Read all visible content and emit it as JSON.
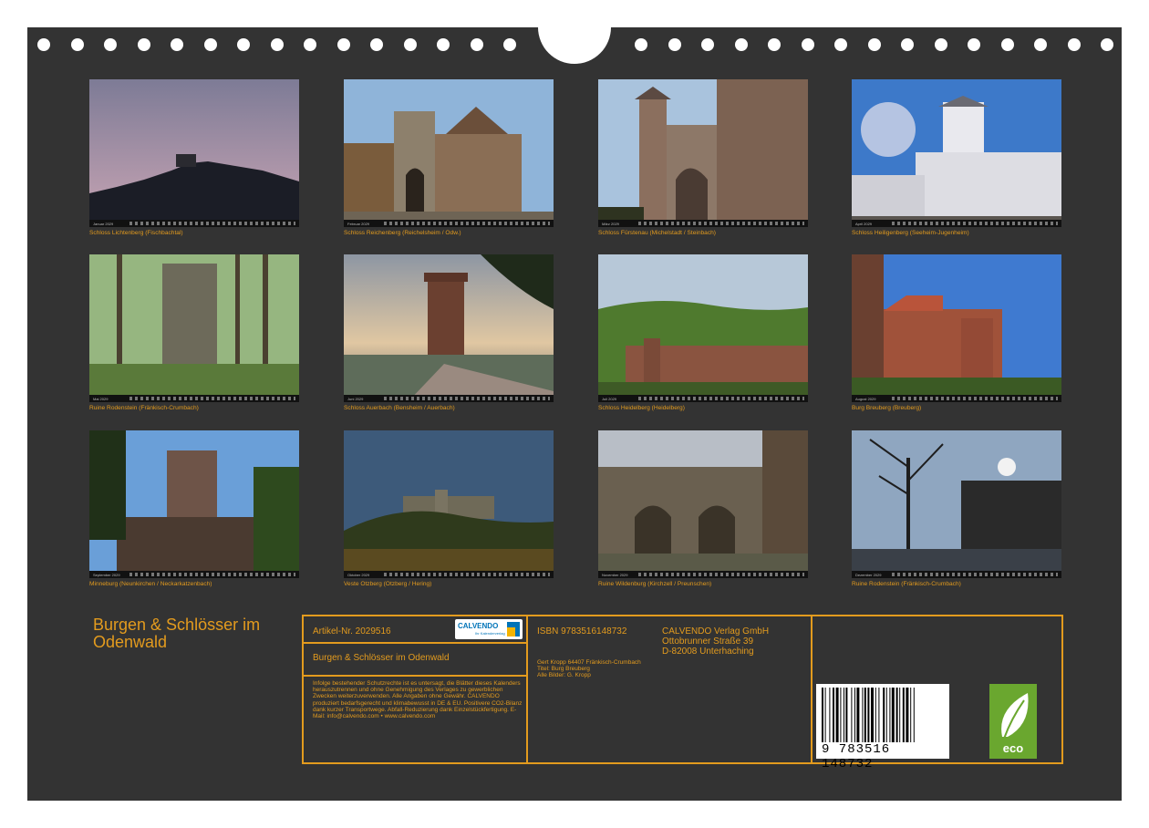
{
  "photos": [
    {
      "month": "Januar 2029",
      "caption": "Schloss Lichtenberg (Fischbachtal)"
    },
    {
      "month": "Februar 2029",
      "caption": "Schloss Reichenberg (Reichelsheim / Odw.)"
    },
    {
      "month": "März 2029",
      "caption": "Schloss Fürstenau (Michelstadt / Steinbach)"
    },
    {
      "month": "April 2029",
      "caption": "Schloss Heiligenberg (Seeheim-Jugenheim)"
    },
    {
      "month": "Mai 2029",
      "caption": "Ruine Rodenstein (Fränkisch-Crumbach)"
    },
    {
      "month": "Juni 2029",
      "caption": "Schloss Auerbach (Bensheim / Auerbach)"
    },
    {
      "month": "Juli 2029",
      "caption": "Schloss Heidelberg (Heidelberg)"
    },
    {
      "month": "August 2029",
      "caption": "Burg Breuberg (Breuberg)"
    },
    {
      "month": "September 2029",
      "caption": "Minneburg (Neunkirchen / Neckarkatzenbach)"
    },
    {
      "month": "Oktober 2029",
      "caption": "Veste Otzberg (Otzberg / Hering)"
    },
    {
      "month": "November 2029",
      "caption": "Ruine Wildenburg (Kirchzell / Preunschen)"
    },
    {
      "month": "Dezember 2029",
      "caption": "Ruine Rodenstein (Fränkisch-Crumbach)"
    }
  ],
  "title": "Burgen & Schlösser im Odenwald",
  "info": {
    "article": "Artikel-Nr. 2029516",
    "logo_text": "CALVENDO",
    "logo_sub": "Ihr Kalenderverlag",
    "title": "Burgen & Schlösser im Odenwald",
    "disclaimer": "Infolge bestehender Schutzrechte ist es untersagt, die Blätter dieses Kalenders herauszutrennen und ohne Genehmigung des Verlages zu gewerblichen Zwecken weiterzuverwenden. Alle Angaben ohne Gewähr. CALVENDO produziert bedarfsgerecht und klimabewusst in DE & EU. Positivere CO2-Bilanz dank kurzer Transportwege. Abfall-Reduzierung dank Einzelstückfertigung. E-Mail: info@calvendo.com • www.calvendo.com",
    "isbn": "ISBN 9783516148732",
    "publisher": [
      "CALVENDO Verlag GmbH",
      "Ottobrunner Straße 39",
      "D-82008 Unterhaching"
    ],
    "credits": [
      "Gert Kropp 64407 Fränkisch-Crumbach",
      "Titel: Burg Breuberg",
      "Alle Bilder: G. Kropp"
    ],
    "barcode_digits": "9 783516 148732",
    "eco_label": "eco"
  },
  "colors": {
    "accent": "#e39b1e",
    "sheet": "#333333",
    "eco": "#6aa72f"
  }
}
